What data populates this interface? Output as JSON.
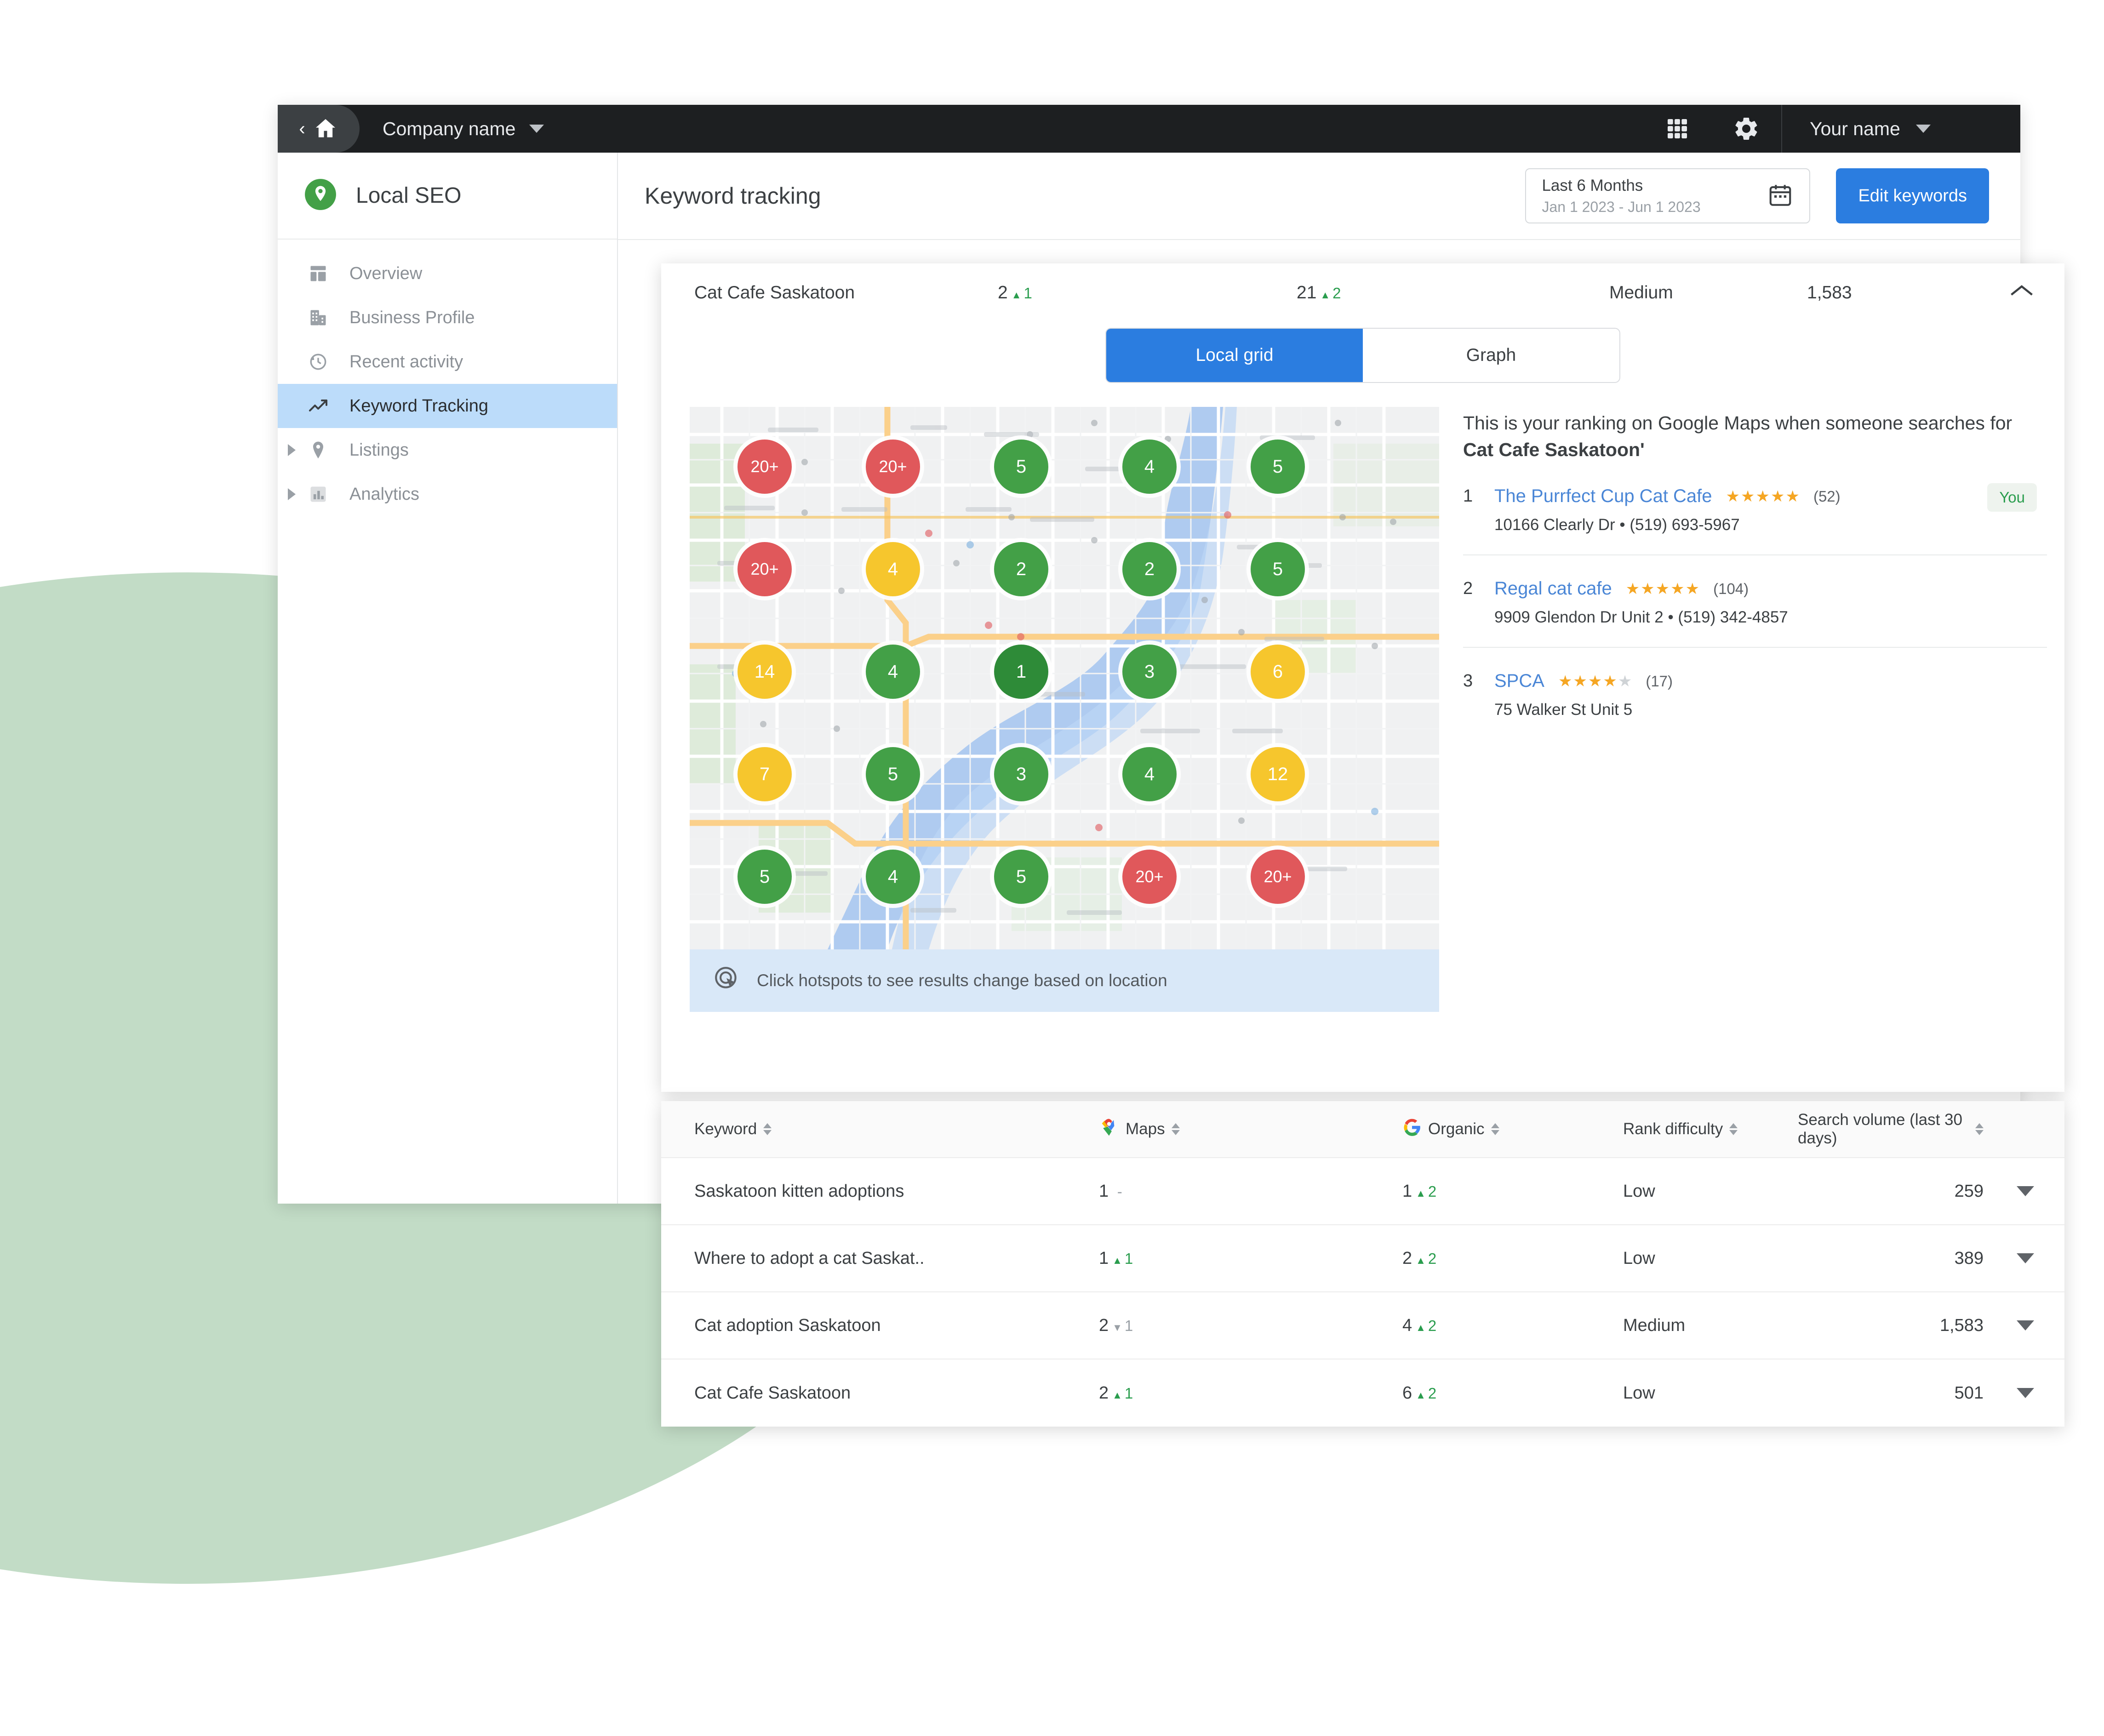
{
  "topbar": {
    "back_icon": "chevron-left-icon",
    "home_icon": "home-icon",
    "company_label": "Company name",
    "apps_icon": "apps-grid-icon",
    "settings_icon": "gear-icon",
    "user_label": "Your name"
  },
  "sidebar": {
    "brand": "Local SEO",
    "items": [
      {
        "label": "Overview",
        "icon": "dashboard-icon",
        "active": false,
        "expandable": false
      },
      {
        "label": "Business Profile",
        "icon": "building-icon",
        "active": false,
        "expandable": false
      },
      {
        "label": "Recent activity",
        "icon": "history-clock-icon",
        "active": false,
        "expandable": false
      },
      {
        "label": "Keyword Tracking",
        "icon": "trending-up-icon",
        "active": true,
        "expandable": false
      },
      {
        "label": "Listings",
        "icon": "map-pin-icon",
        "active": false,
        "expandable": true
      },
      {
        "label": "Analytics",
        "icon": "bar-chart-icon",
        "active": false,
        "expandable": true
      }
    ]
  },
  "page": {
    "title": "Keyword tracking",
    "daterange_label": "Last 6 Months",
    "daterange_value": "Jan 1 2023 - Jun 1 2023",
    "calendar_icon": "calendar-icon",
    "edit_button": "Edit keywords"
  },
  "expanded_keyword": {
    "name": "Cat Cafe Saskatoon",
    "maps_rank": "2",
    "maps_delta": "1",
    "maps_dir": "up",
    "organic_rank": "21",
    "organic_delta": "2",
    "organic_dir": "up",
    "difficulty": "Medium",
    "volume": "1,583",
    "collapse_icon": "chevron-up-icon",
    "tabs": [
      {
        "label": "Local grid",
        "active": true
      },
      {
        "label": "Graph",
        "active": false
      }
    ],
    "map_note": "Click hotspots to see results change based on location",
    "map_note_icon": "click-target-icon",
    "intro_prefix": "This is your ranking on Google Maps when someone searches for ",
    "intro_keyword": "Cat Cafe Saskatoon'",
    "results": [
      {
        "rank": "1",
        "name": "The Purrfect Cup Cat Cafe",
        "stars": 5,
        "reviews": "(52)",
        "address": "10166 Clearly Dr • (519) 693-5967",
        "badge": "You"
      },
      {
        "rank": "2",
        "name": "Regal cat cafe",
        "stars": 5,
        "reviews": "(104)",
        "address": "9909 Glendon Dr Unit 2 • (519) 342-4857",
        "badge": ""
      },
      {
        "rank": "3",
        "name": "SPCA",
        "stars": 4,
        "reviews": "(17)",
        "address": "75 Walker St Unit 5",
        "badge": ""
      }
    ],
    "grid": [
      [
        {
          "v": "20+",
          "c": "red"
        },
        {
          "v": "20+",
          "c": "red"
        },
        {
          "v": "5",
          "c": "green"
        },
        {
          "v": "4",
          "c": "green"
        },
        {
          "v": "5",
          "c": "green"
        }
      ],
      [
        {
          "v": "20+",
          "c": "red"
        },
        {
          "v": "4",
          "c": "yellow"
        },
        {
          "v": "2",
          "c": "green"
        },
        {
          "v": "2",
          "c": "green"
        },
        {
          "v": "5",
          "c": "green"
        }
      ],
      [
        {
          "v": "14",
          "c": "yellow"
        },
        {
          "v": "4",
          "c": "green"
        },
        {
          "v": "1",
          "c": "green-d"
        },
        {
          "v": "3",
          "c": "green"
        },
        {
          "v": "6",
          "c": "yellow"
        }
      ],
      [
        {
          "v": "7",
          "c": "yellow"
        },
        {
          "v": "5",
          "c": "green"
        },
        {
          "v": "3",
          "c": "green"
        },
        {
          "v": "4",
          "c": "green"
        },
        {
          "v": "12",
          "c": "yellow"
        }
      ],
      [
        {
          "v": "5",
          "c": "green"
        },
        {
          "v": "4",
          "c": "green"
        },
        {
          "v": "5",
          "c": "green"
        },
        {
          "v": "20+",
          "c": "red"
        },
        {
          "v": "20+",
          "c": "red"
        }
      ]
    ]
  },
  "keyword_table": {
    "columns": {
      "keyword": "Keyword",
      "maps": "Maps",
      "maps_icon": "google-maps-pin-icon",
      "organic": "Organic",
      "organic_icon": "google-g-icon",
      "difficulty": "Rank difficulty",
      "volume": "Search volume (last 30 days)",
      "sort_icon": "sort-arrows-icon",
      "expand_icon": "chevron-down-icon"
    },
    "rows": [
      {
        "keyword": "Saskatoon kitten adoptions",
        "maps_rank": "1",
        "maps_delta": "",
        "maps_dir": "none",
        "organic_rank": "1",
        "organic_delta": "2",
        "organic_dir": "up",
        "difficulty": "Low",
        "volume": "259"
      },
      {
        "keyword": "Where to adopt a cat Saskat..",
        "maps_rank": "1",
        "maps_delta": "1",
        "maps_dir": "up",
        "organic_rank": "2",
        "organic_delta": "2",
        "organic_dir": "up",
        "difficulty": "Low",
        "volume": "389"
      },
      {
        "keyword": "Cat adoption Saskatoon",
        "maps_rank": "2",
        "maps_delta": "1",
        "maps_dir": "down",
        "organic_rank": "4",
        "organic_delta": "2",
        "organic_dir": "up",
        "difficulty": "Medium",
        "volume": "1,583"
      },
      {
        "keyword": "Cat Cafe Saskatoon",
        "maps_rank": "2",
        "maps_delta": "1",
        "maps_dir": "up",
        "organic_rank": "6",
        "organic_delta": "2",
        "organic_dir": "up",
        "difficulty": "Low",
        "volume": "501"
      }
    ]
  },
  "colors": {
    "accent_blue": "#2b7de0",
    "brand_green": "#43a047",
    "rank_good": "#43a047",
    "rank_mid": "#f6c62d",
    "rank_bad": "#e0585b",
    "decor_green": "#c2dcc6",
    "sidebar_active": "#bcdcfa"
  }
}
